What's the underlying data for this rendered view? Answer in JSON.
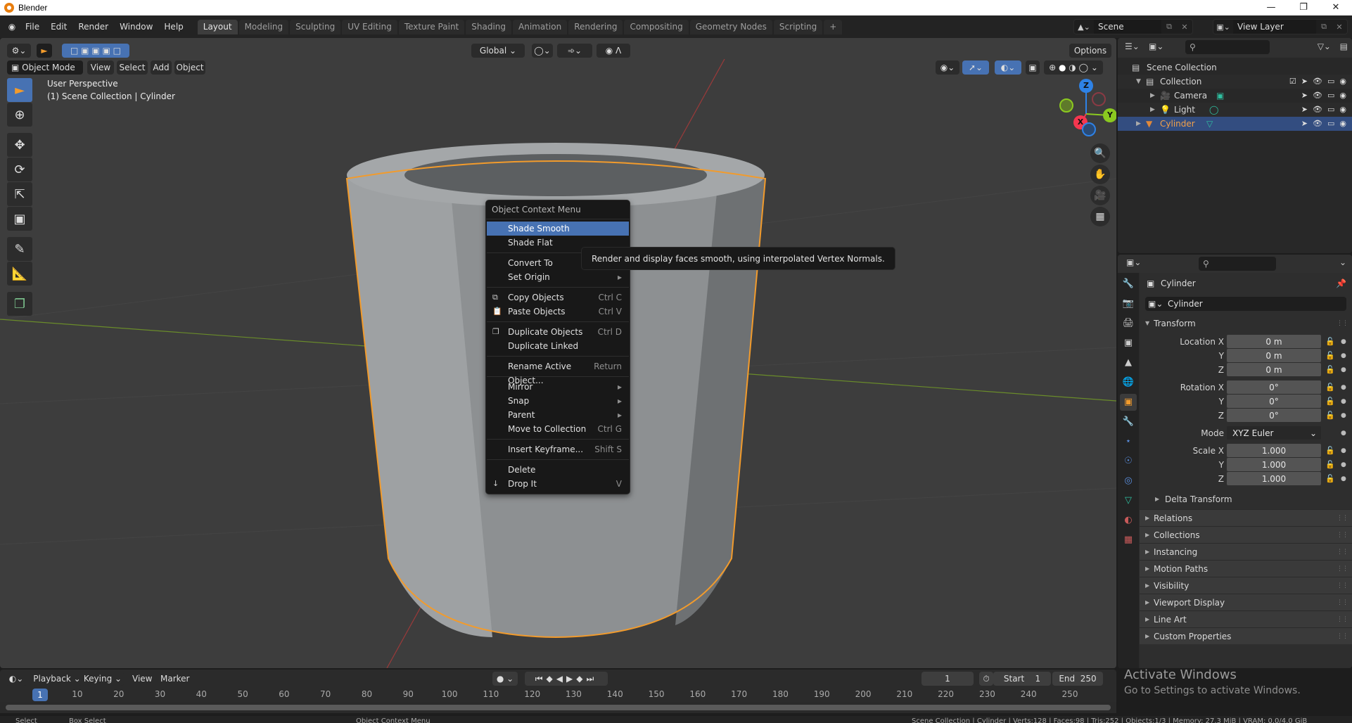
{
  "window": {
    "title": "Blender",
    "controls": [
      "minimize",
      "restore",
      "close"
    ]
  },
  "menubar": {
    "items": [
      "File",
      "Edit",
      "Render",
      "Window",
      "Help"
    ]
  },
  "workspaces": {
    "tabs": [
      "Layout",
      "Modeling",
      "Sculpting",
      "UV Editing",
      "Texture Paint",
      "Shading",
      "Animation",
      "Rendering",
      "Compositing",
      "Geometry Nodes",
      "Scripting"
    ],
    "active": "Layout",
    "add_label": "+"
  },
  "scene": {
    "name": "Scene",
    "view_layer": "View Layer"
  },
  "viewport": {
    "mode": "Object Mode",
    "menus": [
      "View",
      "Select",
      "Add",
      "Object"
    ],
    "transform_orientation": "Global",
    "options_label": "Options",
    "overlay_line1": "User Perspective",
    "overlay_line2": "(1) Scene Collection | Cylinder",
    "gizmo_axes": {
      "x": "X",
      "y": "Y",
      "z": "Z"
    },
    "colors": {
      "x": "#f5364f",
      "y": "#8bc920",
      "z": "#2e82e6",
      "selection": "#f29b2c",
      "active_blue": "#4772b3"
    }
  },
  "context_menu": {
    "title": "Object Context Menu",
    "groups": [
      [
        {
          "label": "Shade Smooth",
          "highlighted": true
        },
        {
          "label": "Shade Flat"
        }
      ],
      [
        {
          "label": "Convert To",
          "submenu": true
        },
        {
          "label": "Set Origin",
          "submenu": true
        }
      ],
      [
        {
          "label": "Copy Objects",
          "shortcut": "Ctrl C",
          "icon": "copy-icon"
        },
        {
          "label": "Paste Objects",
          "shortcut": "Ctrl V",
          "icon": "paste-icon"
        }
      ],
      [
        {
          "label": "Duplicate Objects",
          "shortcut": "Ctrl D",
          "icon": "duplicate-icon"
        },
        {
          "label": "Duplicate Linked"
        }
      ],
      [
        {
          "label": "Rename Active Object...",
          "shortcut": "Return"
        }
      ],
      [
        {
          "label": "Mirror",
          "submenu": true
        },
        {
          "label": "Snap",
          "submenu": true
        },
        {
          "label": "Parent",
          "submenu": true
        },
        {
          "label": "Move to Collection",
          "shortcut": "Ctrl G"
        }
      ],
      [
        {
          "label": "Insert Keyframe...",
          "shortcut": "Shift S"
        }
      ],
      [
        {
          "label": "Delete"
        },
        {
          "label": "Drop It",
          "shortcut": "V",
          "icon": "arrow-down-icon"
        }
      ]
    ]
  },
  "tooltip": {
    "text": "Render and display faces smooth, using interpolated Vertex Normals."
  },
  "outliner": {
    "root": "Scene Collection",
    "items": [
      {
        "label": "Collection",
        "level": 1,
        "checked": true
      },
      {
        "label": "Camera",
        "level": 2
      },
      {
        "label": "Light",
        "level": 2
      },
      {
        "label": "Cylinder",
        "level": 1,
        "selected": true
      }
    ]
  },
  "properties": {
    "object_name": "Cylinder",
    "datablock_name": "Cylinder",
    "transform_label": "Transform",
    "location": {
      "label": "Location X",
      "x": "0 m",
      "y": "0 m",
      "z": "0 m"
    },
    "rotation": {
      "label": "Rotation X",
      "x": "0°",
      "y": "0°",
      "z": "0°"
    },
    "mode": {
      "label": "Mode",
      "value": "XYZ Euler"
    },
    "scale": {
      "label": "Scale X",
      "x": "1.000",
      "y": "1.000",
      "z": "1.000"
    },
    "axis_labels": {
      "y": "Y",
      "z": "Z"
    },
    "delta_transform": "Delta Transform",
    "panels": [
      "Relations",
      "Collections",
      "Instancing",
      "Motion Paths",
      "Visibility",
      "Viewport Display",
      "Line Art",
      "Custom Properties"
    ]
  },
  "timeline": {
    "menus": [
      "Playback",
      "Keying",
      "View",
      "Marker"
    ],
    "current_frame": "1",
    "start_label": "Start",
    "start": "1",
    "end_label": "End",
    "end": "250",
    "ticks": [
      "10",
      "20",
      "30",
      "40",
      "50",
      "60",
      "70",
      "80",
      "90",
      "100",
      "110",
      "120",
      "130",
      "140",
      "150",
      "160",
      "170",
      "180",
      "190",
      "200",
      "210",
      "220",
      "230",
      "240",
      "250"
    ],
    "playhead_label": "1"
  },
  "watermark": {
    "line1": "Activate Windows",
    "line2": "Go to Settings to activate Windows."
  },
  "statusbar": {
    "left": [
      "Select",
      "Box Select",
      "Object Context Menu"
    ],
    "right": "Scene Collection | Cylinder | Verts:128 | Faces:98 | Tris:252 | Objects:1/3 | Memory: 27.3 MiB | VRAM: 0.0/4.0 GiB"
  }
}
